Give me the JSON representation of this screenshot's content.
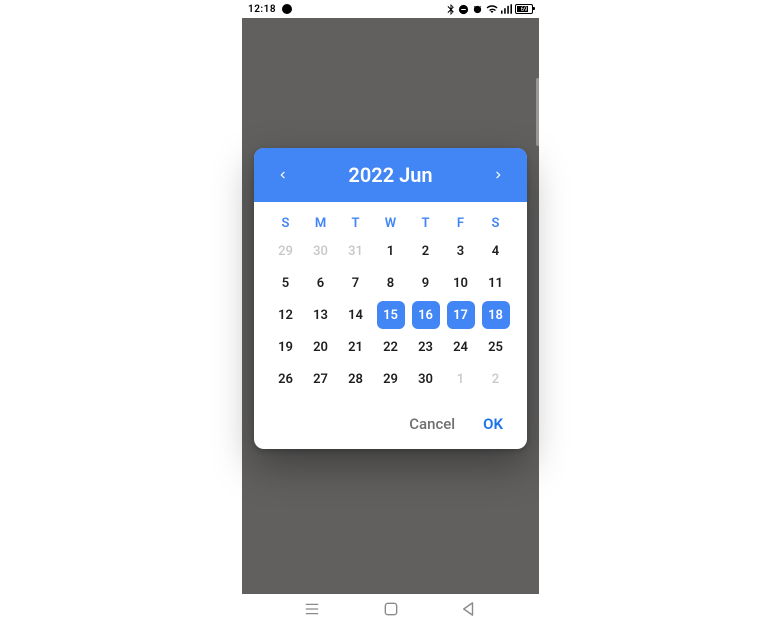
{
  "status": {
    "time": "12:18",
    "battery_pct": "69"
  },
  "dialog": {
    "title": "2022 Jun",
    "dow": [
      "S",
      "M",
      "T",
      "W",
      "T",
      "F",
      "S"
    ],
    "weeks": [
      [
        {
          "n": "29",
          "out": true,
          "sel": false
        },
        {
          "n": "30",
          "out": true,
          "sel": false
        },
        {
          "n": "31",
          "out": true,
          "sel": false
        },
        {
          "n": "1",
          "out": false,
          "sel": false
        },
        {
          "n": "2",
          "out": false,
          "sel": false
        },
        {
          "n": "3",
          "out": false,
          "sel": false
        },
        {
          "n": "4",
          "out": false,
          "sel": false
        }
      ],
      [
        {
          "n": "5",
          "out": false,
          "sel": false
        },
        {
          "n": "6",
          "out": false,
          "sel": false
        },
        {
          "n": "7",
          "out": false,
          "sel": false
        },
        {
          "n": "8",
          "out": false,
          "sel": false
        },
        {
          "n": "9",
          "out": false,
          "sel": false
        },
        {
          "n": "10",
          "out": false,
          "sel": false
        },
        {
          "n": "11",
          "out": false,
          "sel": false
        }
      ],
      [
        {
          "n": "12",
          "out": false,
          "sel": false
        },
        {
          "n": "13",
          "out": false,
          "sel": false
        },
        {
          "n": "14",
          "out": false,
          "sel": false
        },
        {
          "n": "15",
          "out": false,
          "sel": true
        },
        {
          "n": "16",
          "out": false,
          "sel": true
        },
        {
          "n": "17",
          "out": false,
          "sel": true
        },
        {
          "n": "18",
          "out": false,
          "sel": true
        }
      ],
      [
        {
          "n": "19",
          "out": false,
          "sel": false
        },
        {
          "n": "20",
          "out": false,
          "sel": false
        },
        {
          "n": "21",
          "out": false,
          "sel": false
        },
        {
          "n": "22",
          "out": false,
          "sel": false
        },
        {
          "n": "23",
          "out": false,
          "sel": false
        },
        {
          "n": "24",
          "out": false,
          "sel": false
        },
        {
          "n": "25",
          "out": false,
          "sel": false
        }
      ],
      [
        {
          "n": "26",
          "out": false,
          "sel": false
        },
        {
          "n": "27",
          "out": false,
          "sel": false
        },
        {
          "n": "28",
          "out": false,
          "sel": false
        },
        {
          "n": "29",
          "out": false,
          "sel": false
        },
        {
          "n": "30",
          "out": false,
          "sel": false
        },
        {
          "n": "1",
          "out": true,
          "sel": false
        },
        {
          "n": "2",
          "out": true,
          "sel": false
        }
      ]
    ],
    "cancel_label": "Cancel",
    "ok_label": "OK"
  }
}
